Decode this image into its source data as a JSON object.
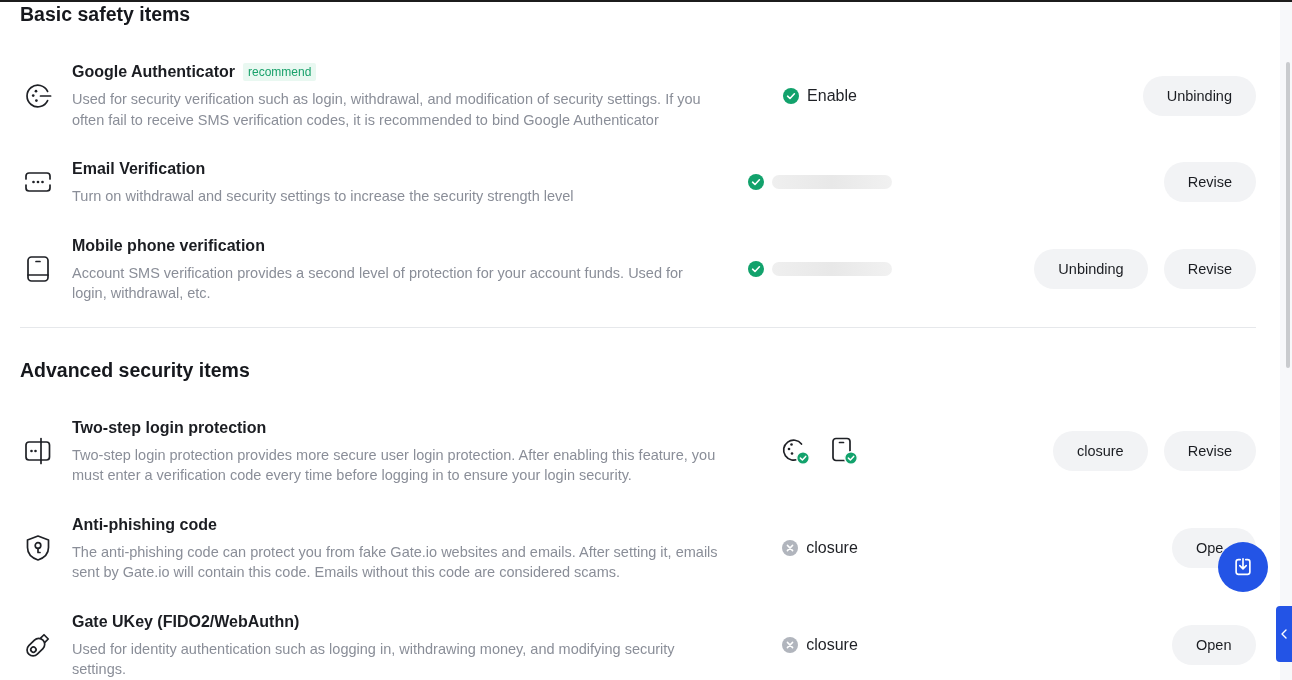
{
  "sections": [
    {
      "title": "Basic safety items",
      "items": [
        {
          "kind": "authenticator",
          "title": "Google Authenticator",
          "badge": "recommend",
          "description_lines": [
            "Used for security verification such as login, withdrawal, and modification of security settings. If you",
            "often fail to receive SMS verification codes, it is recommended to bind Google Authenticator"
          ],
          "status": {
            "kind": "text",
            "verified": true,
            "label": "Enable"
          },
          "buttons": [
            "Unbinding"
          ]
        },
        {
          "kind": "email",
          "title": "Email Verification",
          "description_lines": [
            "Turn on withdrawal and security settings to increase the security strength level"
          ],
          "status": {
            "kind": "redacted",
            "verified": true
          },
          "buttons": [
            "Revise"
          ]
        },
        {
          "kind": "phone",
          "title": "Mobile phone verification",
          "description_lines": [
            "Account SMS verification provides a second level of protection for your account funds. Used for",
            "login, withdrawal, etc."
          ],
          "status": {
            "kind": "redacted",
            "verified": true
          },
          "buttons": [
            "Unbinding",
            "Revise"
          ]
        }
      ]
    },
    {
      "title": "Advanced security items",
      "items": [
        {
          "kind": "two_step",
          "title": "Two-step login protection",
          "description_lines": [
            "Two-step login protection provides more secure user login protection. After enabling this feature, you",
            "must enter a verification code every time before logging in to ensure your login security."
          ],
          "status": {
            "kind": "methods",
            "methods": [
              {
                "kind": "authenticator",
                "verified": true
              },
              {
                "kind": "phone",
                "verified": true
              }
            ]
          },
          "buttons": [
            "closure",
            "Revise"
          ]
        },
        {
          "kind": "anti_phishing",
          "title": "Anti-phishing code",
          "description_lines": [
            "The anti-phishing code can protect you from fake Gate.io websites and emails. After setting it, emails",
            "sent by Gate.io will contain this code. Emails without this code are considered scams."
          ],
          "status": {
            "kind": "text",
            "verified": false,
            "label": "closure"
          },
          "buttons": [
            "Ope"
          ]
        },
        {
          "kind": "ukey",
          "title": "Gate UKey (FIDO2/WebAuthn)",
          "description_lines": [
            "Used for identity authentication such as logging in, withdrawing money, and modifying security",
            "settings."
          ],
          "status": {
            "kind": "text",
            "verified": false,
            "label": "closure"
          },
          "buttons": [
            "Open"
          ]
        }
      ]
    }
  ]
}
